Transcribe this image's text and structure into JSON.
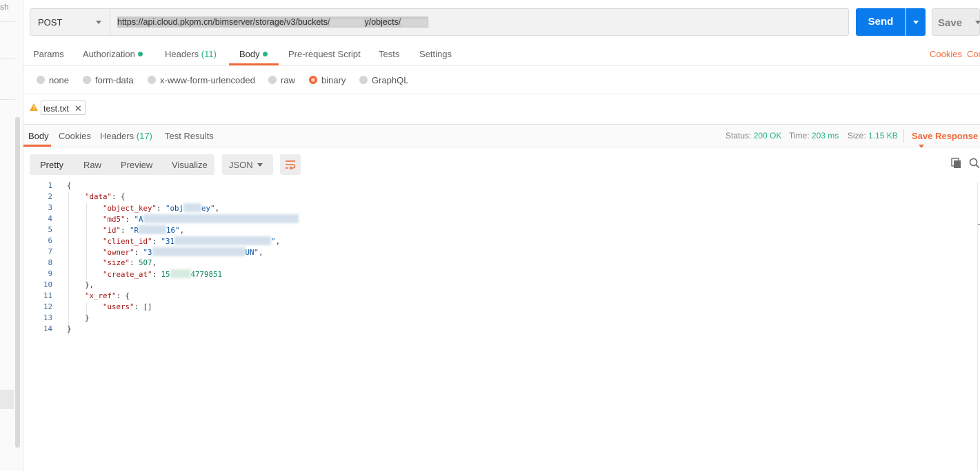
{
  "sidebar": {
    "stub_text": "sh"
  },
  "request": {
    "method": "POST",
    "url_prefix": "https://api.cloud.pkpm.cn/bimserver/storage/v3/buckets/",
    "url_mid": "y/objects/",
    "send_label": "Send",
    "save_label": "Save"
  },
  "req_tabs": {
    "params": "Params",
    "authorization": "Authorization",
    "headers": "Headers",
    "headers_count": "(11)",
    "body": "Body",
    "prerequest": "Pre-request Script",
    "tests": "Tests",
    "settings": "Settings",
    "cookies": "Cookies",
    "code": "Coc"
  },
  "body_types": {
    "none": "none",
    "form_data": "form-data",
    "urlencoded": "x-www-form-urlencoded",
    "raw": "raw",
    "binary": "binary",
    "graphql": "GraphQL",
    "selected": "binary"
  },
  "file": {
    "name": "test.txt",
    "remove": "✕"
  },
  "resp_tabs": {
    "body": "Body",
    "cookies": "Cookies",
    "headers": "Headers",
    "headers_count": "(17)",
    "test_results": "Test Results"
  },
  "status": {
    "status_label": "Status:",
    "status_value": "200 OK",
    "time_label": "Time:",
    "time_value": "203 ms",
    "size_label": "Size:",
    "size_value": "1.15 KB",
    "save_response": "Save Response"
  },
  "view": {
    "pretty": "Pretty",
    "raw": "Raw",
    "preview": "Preview",
    "visualize": "Visualize",
    "format": "JSON"
  },
  "code": {
    "line_numbers": [
      "1",
      "2",
      "3",
      "4",
      "5",
      "6",
      "7",
      "8",
      "9",
      "10",
      "11",
      "12",
      "13",
      "14"
    ],
    "l1": "{",
    "l2_key": "\"data\"",
    "l2_rest": ": {",
    "l3_key": "\"object_key\"",
    "l3_sep": ": ",
    "l3_v1": "\"obj",
    "l3_v2": "ey\"",
    "l3_end": ",",
    "l4_key": "\"md5\"",
    "l4_sep": ": ",
    "l4_v1": "\"A",
    "l5_key": "\"id\"",
    "l5_sep": ": ",
    "l5_v1": "\"R",
    "l5_v2": "16\"",
    "l5_end": ",",
    "l6_key": "\"client_id\"",
    "l6_sep": ": ",
    "l6_v1": "\"31",
    "l6_v2": "\"",
    "l6_end": ",",
    "l7_key": "\"owner\"",
    "l7_sep": ": ",
    "l7_v1": "\"3",
    "l7_v2": "UN\"",
    "l7_end": ",",
    "l8_key": "\"size\"",
    "l8_sep": ": ",
    "l8_val": "507",
    "l8_end": ",",
    "l9_key": "\"create_at\"",
    "l9_sep": ": ",
    "l9_v1": "15",
    "l9_v2": "4779851",
    "l10": "},",
    "l11_key": "\"x_ref\"",
    "l11_rest": ": {",
    "l12_key": "\"users\"",
    "l12_rest": ": []",
    "l13": "}",
    "l14": "}"
  },
  "colors": {
    "accent": "#f26b3a",
    "send_blue": "#097bed",
    "ok_green": "#26b47f"
  }
}
